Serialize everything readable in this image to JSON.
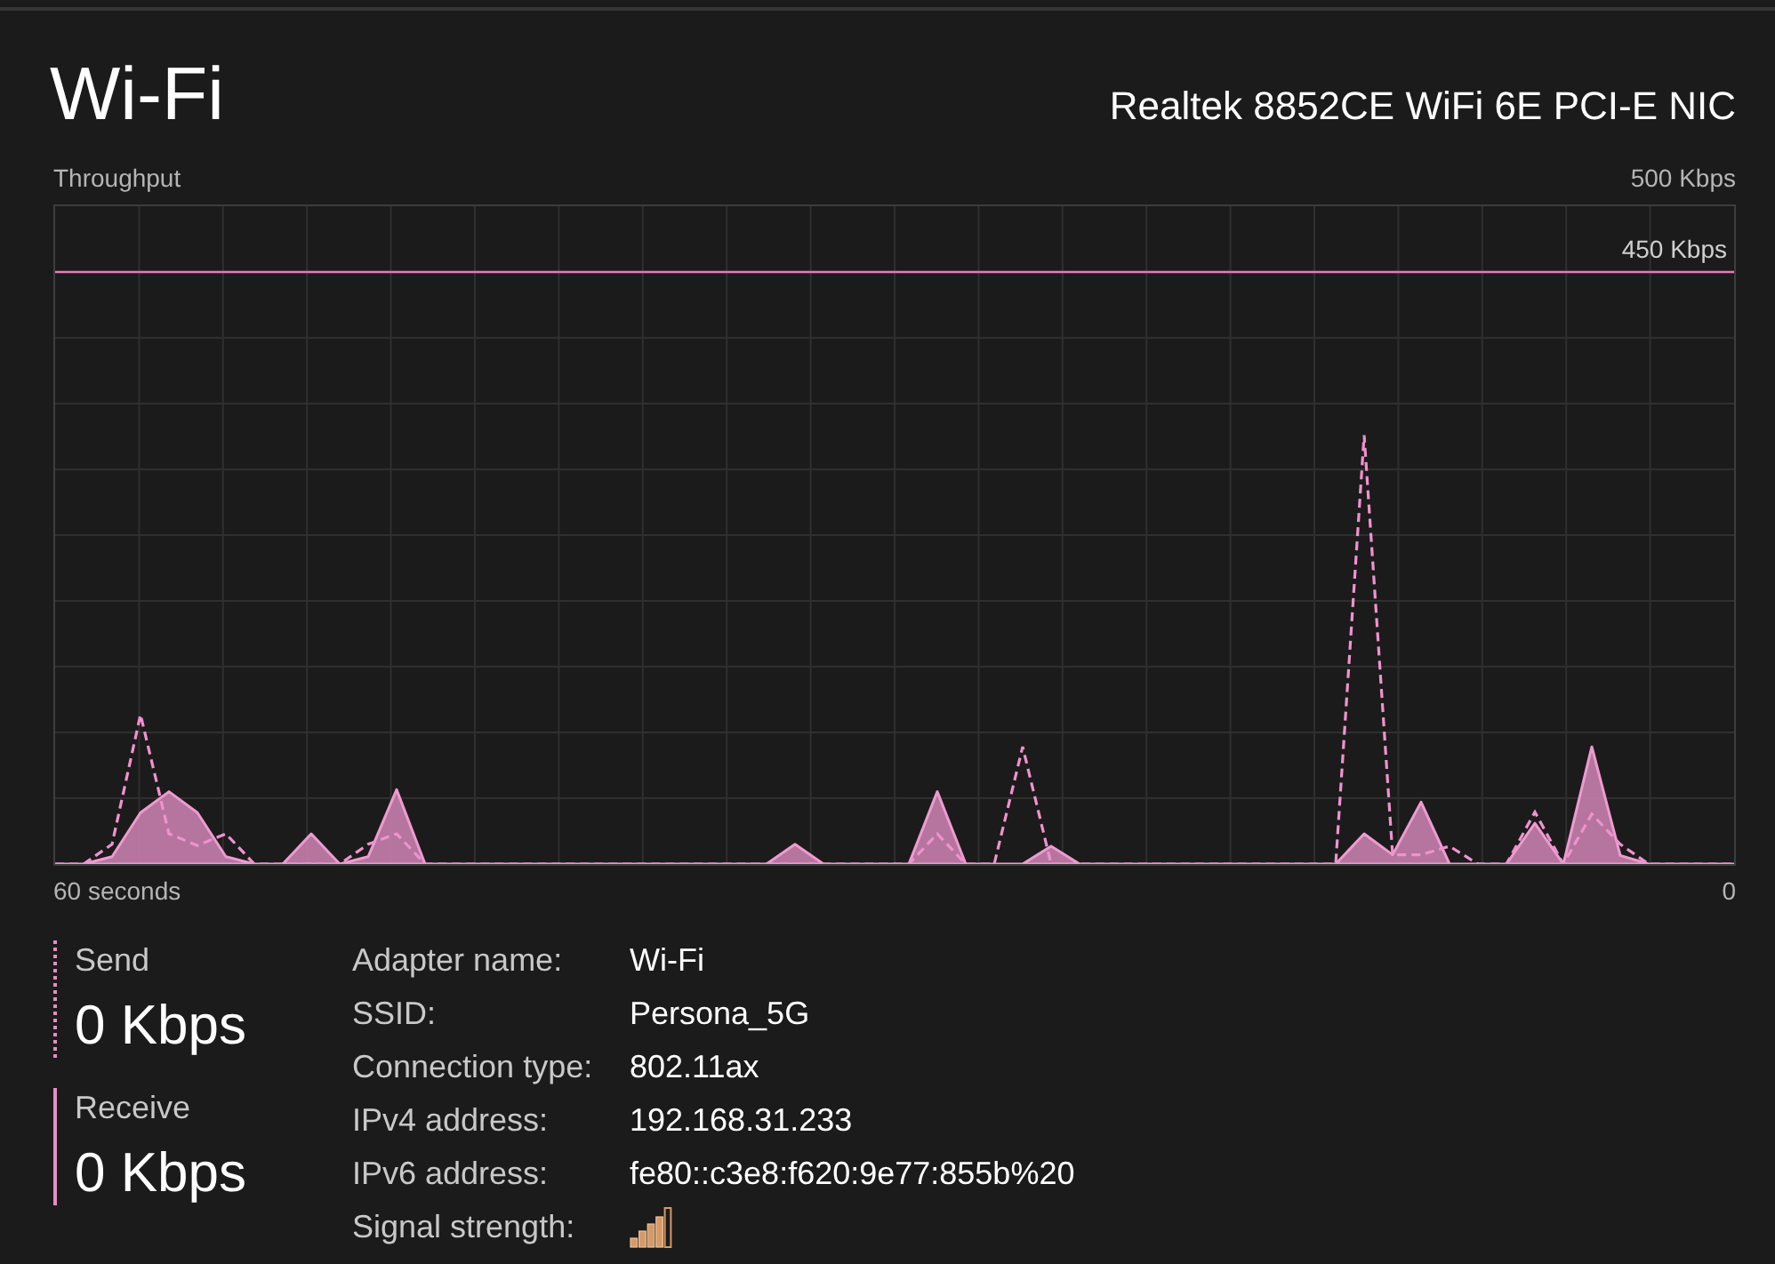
{
  "header": {
    "title": "Wi-Fi",
    "adapter": "Realtek 8852CE WiFi 6E PCI-E NIC"
  },
  "graph": {
    "label": "Throughput",
    "max_label": "500 Kbps",
    "scale_line_label": "450 Kbps",
    "time_start_label": "60 seconds",
    "time_end_label": "0"
  },
  "legend": [
    {
      "kind": "send",
      "label": "Send",
      "value": "0 Kbps"
    },
    {
      "kind": "receive",
      "label": "Receive",
      "value": "0 Kbps"
    }
  ],
  "details": [
    {
      "kind": "text",
      "label": "Adapter name:",
      "value": "Wi-Fi"
    },
    {
      "kind": "text",
      "label": "SSID:",
      "value": "Persona_5G"
    },
    {
      "kind": "text",
      "label": "Connection type:",
      "value": "802.11ax"
    },
    {
      "kind": "text",
      "label": "IPv4 address:",
      "value": "192.168.31.233"
    },
    {
      "kind": "text",
      "label": "IPv6 address:",
      "value": "fe80::c3e8:f620:9e77:855b%20"
    },
    {
      "kind": "signal",
      "label": "Signal strength:"
    }
  ]
}
